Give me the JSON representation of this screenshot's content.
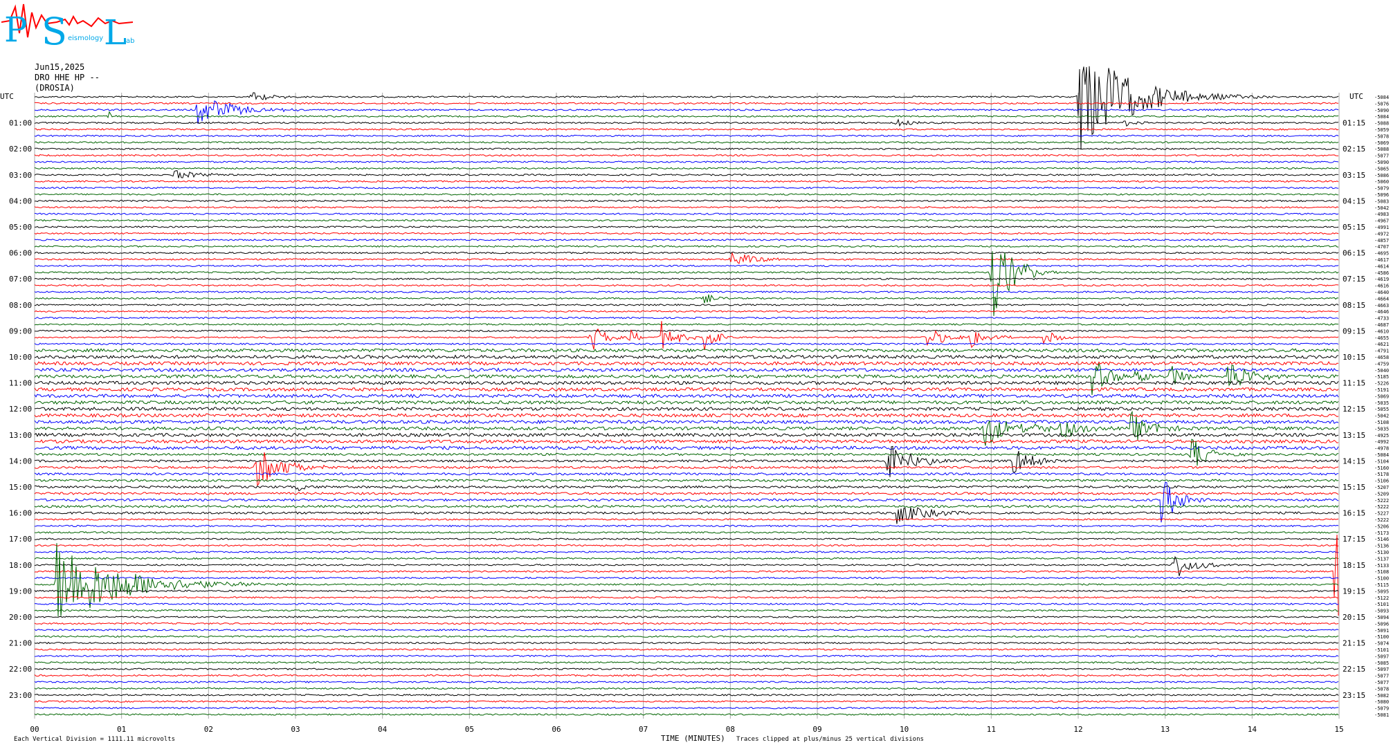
{
  "header": {
    "date": "Jun15,2025",
    "station": "DRO HHE HP --",
    "site": "(DROSIA)"
  },
  "logo": {
    "letters": [
      "P",
      "S",
      "L"
    ],
    "small_words": [
      "eismology",
      "ab"
    ]
  },
  "footer": {
    "scale_note": "Each Vertical Division = 1111.11 microvolts",
    "x_title": "TIME (MINUTES)",
    "clip_note": "Traces clipped at plus/minus 25 vertical divisions"
  },
  "colors": {
    "trace_cycle": [
      "#000000",
      "#ff0000",
      "#0000ff",
      "#006400"
    ],
    "logo_blue": "#00a8e8",
    "logo_red": "#ff0000",
    "grid": "#aaaaaa"
  },
  "chart_data": {
    "type": "line",
    "x_label": "TIME (MINUTES)",
    "x_range": [
      0,
      15
    ],
    "x_ticks": [
      "00",
      "01",
      "02",
      "03",
      "04",
      "05",
      "06",
      "07",
      "08",
      "09",
      "10",
      "11",
      "12",
      "13",
      "14",
      "15"
    ],
    "left_label_header": "UTC",
    "right_label_header": "UTC",
    "left_hour_labels": [
      "01:00",
      "02:00",
      "03:00",
      "04:00",
      "05:00",
      "06:00",
      "07:00",
      "08:00",
      "09:00",
      "10:00",
      "11:00",
      "12:00",
      "13:00",
      "14:00",
      "15:00",
      "16:00",
      "17:00",
      "18:00",
      "19:00",
      "20:00",
      "21:00",
      "22:00",
      "23:00"
    ],
    "right_hour_labels": [
      "01:15",
      "02:15",
      "03:15",
      "04:15",
      "05:15",
      "06:15",
      "07:15",
      "08:15",
      "09:15",
      "10:15",
      "11:15",
      "12:15",
      "13:15",
      "14:15",
      "15:15",
      "16:15",
      "17:15",
      "18:15",
      "19:15",
      "20:15",
      "21:15",
      "22:15",
      "23:15"
    ],
    "trace_count": 96,
    "trace_minutes": 15,
    "trace_offsets": [
      -5084,
      -5076,
      -5090,
      -5084,
      -5088,
      -5059,
      -5078,
      -5069,
      -5088,
      -5077,
      -5090,
      -5065,
      -5086,
      -5060,
      -5079,
      -5096,
      -5083,
      -5042,
      -4983,
      -4967,
      -4991,
      -4972,
      -4857,
      -4707,
      -4695,
      -4617,
      -4614,
      -4586,
      -4619,
      -4616,
      -4640,
      -4664,
      -4663,
      -4646,
      -4733,
      -4687,
      -4610,
      -4655,
      -4621,
      -4791,
      -4658,
      -4759,
      -5040,
      -5185,
      -5226,
      -5191,
      -5069,
      -5035,
      -5055,
      -5042,
      -5108,
      -5035,
      -4925,
      -4992,
      -4978,
      -5084,
      -5104,
      -5160,
      -5178,
      -5106,
      -5207,
      -5209,
      -5222,
      -5222,
      -5227,
      -5222,
      -5206,
      -5173,
      -5146,
      -5136,
      -5130,
      -5137,
      -5133,
      -5108,
      -5100,
      -5115,
      -5095,
      -5122,
      -5101,
      -5093,
      -5094,
      -5096,
      -5091,
      -5100,
      -5074,
      -5101,
      -5097,
      -5085,
      -5097,
      -5077,
      -5077,
      -5078,
      -5082,
      -5080,
      -5079,
      -5081
    ],
    "events": [
      {
        "trace": 0,
        "minute": 2.5,
        "amp": 0.8,
        "dur": 0.4
      },
      {
        "trace": 2,
        "minute": 1.85,
        "amp": 2.6,
        "dur": 0.6
      },
      {
        "trace": 3,
        "minute": 0.85,
        "amp": 1.3,
        "dur": 0.06
      },
      {
        "trace": 4,
        "minute": 9.9,
        "amp": 0.7,
        "dur": 0.3
      },
      {
        "trace": 0,
        "minute": 12.0,
        "amp": 9.0,
        "dur": 0.9
      },
      {
        "trace": 4,
        "minute": 12.5,
        "amp": 0.7,
        "dur": 0.3
      },
      {
        "trace": 12,
        "minute": 1.6,
        "amp": 0.8,
        "dur": 0.5
      },
      {
        "trace": 25,
        "minute": 8.0,
        "amp": 1.4,
        "dur": 0.4
      },
      {
        "trace": 27,
        "minute": 11.0,
        "amp": 8.0,
        "dur": 0.35
      },
      {
        "trace": 31,
        "minute": 7.7,
        "amp": 0.8,
        "dur": 0.2
      },
      {
        "trace": 37,
        "minute": 6.4,
        "amp": 2.5,
        "dur": 0.25
      },
      {
        "trace": 37,
        "minute": 6.8,
        "amp": 1.6,
        "dur": 0.2
      },
      {
        "trace": 37,
        "minute": 7.2,
        "amp": 2.8,
        "dur": 0.25
      },
      {
        "trace": 37,
        "minute": 7.7,
        "amp": 2.5,
        "dur": 0.2
      },
      {
        "trace": 37,
        "minute": 10.25,
        "amp": 1.9,
        "dur": 0.3
      },
      {
        "trace": 37,
        "minute": 10.75,
        "amp": 1.8,
        "dur": 0.3
      },
      {
        "trace": 37,
        "minute": 11.6,
        "amp": 1.3,
        "dur": 0.25
      },
      {
        "trace": 43,
        "minute": 12.15,
        "amp": 3.0,
        "dur": 0.35
      },
      {
        "trace": 43,
        "minute": 12.6,
        "amp": 1.8,
        "dur": 0.25
      },
      {
        "trace": 43,
        "minute": 13.05,
        "amp": 2.4,
        "dur": 0.25
      },
      {
        "trace": 43,
        "minute": 13.7,
        "amp": 3.0,
        "dur": 0.4
      },
      {
        "trace": 51,
        "minute": 10.9,
        "amp": 3.5,
        "dur": 0.4
      },
      {
        "trace": 51,
        "minute": 11.5,
        "amp": 1.6,
        "dur": 0.2
      },
      {
        "trace": 51,
        "minute": 11.8,
        "amp": 3.0,
        "dur": 0.25
      },
      {
        "trace": 51,
        "minute": 12.6,
        "amp": 2.6,
        "dur": 0.35
      },
      {
        "trace": 55,
        "minute": 13.3,
        "amp": 2.8,
        "dur": 0.3
      },
      {
        "trace": 56,
        "minute": 9.8,
        "amp": 3.0,
        "dur": 0.45
      },
      {
        "trace": 56,
        "minute": 11.25,
        "amp": 2.4,
        "dur": 0.35
      },
      {
        "trace": 57,
        "minute": 2.55,
        "amp": 3.0,
        "dur": 0.5
      },
      {
        "trace": 60,
        "minute": 3.0,
        "amp": 0.6,
        "dur": 0.3
      },
      {
        "trace": 62,
        "minute": 12.95,
        "amp": 4.0,
        "dur": 0.3
      },
      {
        "trace": 64,
        "minute": 9.9,
        "amp": 2.0,
        "dur": 0.5
      },
      {
        "trace": 72,
        "minute": 13.1,
        "amp": 2.3,
        "dur": 0.35
      },
      {
        "trace": 75,
        "minute": 0.25,
        "amp": 7.0,
        "dur": 1.1
      },
      {
        "trace": 73,
        "minute": 14.95,
        "amp": 14.0,
        "dur": 1.0
      }
    ]
  }
}
